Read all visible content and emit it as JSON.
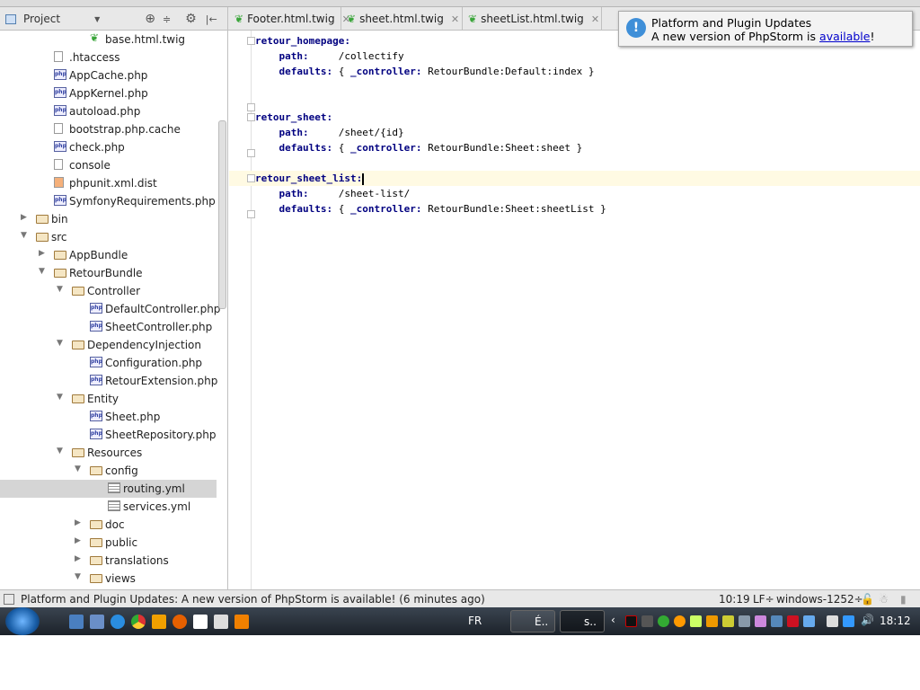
{
  "toolbar": {
    "project_label": "Project",
    "tabs": [
      {
        "label": "Footer.html.twig"
      },
      {
        "label": "sheet.html.twig"
      },
      {
        "label": "sheetList.html.twig"
      }
    ]
  },
  "notification": {
    "title": "Platform and Plugin Updates",
    "message_prefix": "A new version of PhpStorm is ",
    "link": "available",
    "message_suffix": "!"
  },
  "tree": [
    {
      "label": "base.html.twig",
      "icon": "twig",
      "level": 4
    },
    {
      "label": ".htaccess",
      "icon": "file",
      "level": 2
    },
    {
      "label": "AppCache.php",
      "icon": "php",
      "level": 2
    },
    {
      "label": "AppKernel.php",
      "icon": "php",
      "level": 2
    },
    {
      "label": "autoload.php",
      "icon": "php",
      "level": 2
    },
    {
      "label": "bootstrap.php.cache",
      "icon": "file",
      "level": 2
    },
    {
      "label": "check.php",
      "icon": "php",
      "level": 2
    },
    {
      "label": "console",
      "icon": "file",
      "level": 2
    },
    {
      "label": "phpunit.xml.dist",
      "icon": "xml",
      "level": 2
    },
    {
      "label": "SymfonyRequirements.php",
      "icon": "php",
      "level": 2
    },
    {
      "label": "bin",
      "icon": "folder",
      "level": 1,
      "arrow": "collapsed"
    },
    {
      "label": "src",
      "icon": "folder",
      "level": 1,
      "arrow": "expanded"
    },
    {
      "label": "AppBundle",
      "icon": "folder",
      "level": 2,
      "arrow": "collapsed"
    },
    {
      "label": "RetourBundle",
      "icon": "folder",
      "level": 2,
      "arrow": "expanded"
    },
    {
      "label": "Controller",
      "icon": "folder",
      "level": 3,
      "arrow": "expanded"
    },
    {
      "label": "DefaultController.php",
      "icon": "php",
      "level": 4
    },
    {
      "label": "SheetController.php",
      "icon": "php",
      "level": 4
    },
    {
      "label": "DependencyInjection",
      "icon": "folder",
      "level": 3,
      "arrow": "expanded"
    },
    {
      "label": "Configuration.php",
      "icon": "php",
      "level": 4
    },
    {
      "label": "RetourExtension.php",
      "icon": "php",
      "level": 4
    },
    {
      "label": "Entity",
      "icon": "folder",
      "level": 3,
      "arrow": "expanded"
    },
    {
      "label": "Sheet.php",
      "icon": "php",
      "level": 4
    },
    {
      "label": "SheetRepository.php",
      "icon": "php",
      "level": 4
    },
    {
      "label": "Resources",
      "icon": "folder",
      "level": 3,
      "arrow": "expanded"
    },
    {
      "label": "config",
      "icon": "folder",
      "level": 4,
      "arrow": "expanded"
    },
    {
      "label": "routing.yml",
      "icon": "yml",
      "level": 5,
      "selected": true
    },
    {
      "label": "services.yml",
      "icon": "yml",
      "level": 5
    },
    {
      "label": "doc",
      "icon": "folder",
      "level": 4,
      "arrow": "collapsed"
    },
    {
      "label": "public",
      "icon": "folder",
      "level": 4,
      "arrow": "collapsed"
    },
    {
      "label": "translations",
      "icon": "folder",
      "level": 4,
      "arrow": "collapsed"
    },
    {
      "label": "views",
      "icon": "folder",
      "level": 4,
      "arrow": "expanded"
    }
  ],
  "code": [
    {
      "key": "retour_homepage:",
      "value": "",
      "indent": 0,
      "fold": true
    },
    {
      "key": "path:",
      "value": "     /collectify",
      "indent": 1
    },
    {
      "key": "defaults:",
      "value": " { _controller: RetourBundle:Default:index }",
      "indent": 1,
      "ctl": true
    },
    {
      "key": "",
      "value": "",
      "indent": 0
    },
    {
      "key": "",
      "value": "",
      "indent": 0,
      "foldend": true
    },
    {
      "key": "retour_sheet:",
      "value": "",
      "indent": 0,
      "fold": true
    },
    {
      "key": "path:",
      "value": "     /sheet/{id}",
      "indent": 1
    },
    {
      "key": "defaults:",
      "value": " { _controller: RetourBundle:Sheet:sheet }",
      "indent": 1,
      "ctl": true,
      "foldend": true
    },
    {
      "key": "",
      "value": "",
      "indent": 0
    },
    {
      "key": "retour_sheet_list:",
      "value": "",
      "indent": 0,
      "fold": true,
      "current": true
    },
    {
      "key": "path:",
      "value": "     /sheet-list/",
      "indent": 1
    },
    {
      "key": "defaults:",
      "value": " { _controller: RetourBundle:Sheet:sheetList }",
      "indent": 1,
      "ctl": true,
      "foldend": true
    }
  ],
  "status": {
    "message": "Platform and Plugin Updates: A new version of PhpStorm is available! (6 minutes ago)",
    "position": "10:19",
    "line_sep": "LF÷",
    "encoding": "windows-1252÷"
  },
  "taskbar": {
    "lang": "FR",
    "tasks": [
      {
        "label": "É.."
      },
      {
        "label": "s.."
      }
    ],
    "clock": "18:12"
  }
}
